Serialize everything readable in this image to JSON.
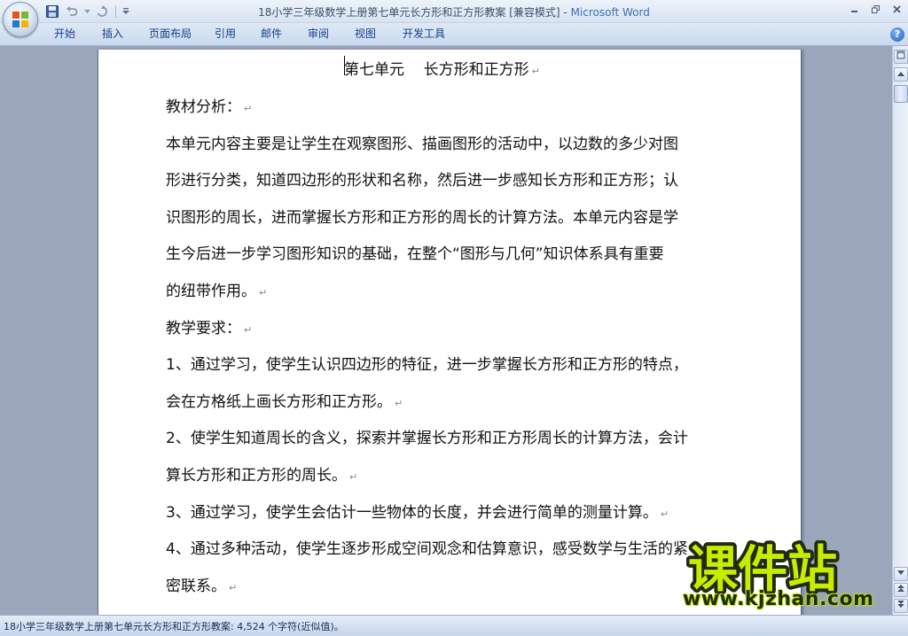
{
  "window": {
    "title_doc": "18小学三年级数学上册第七单元长方形和正方形教案 [兼容模式] - ",
    "title_app": "Microsoft Word"
  },
  "ribbon": {
    "tabs": [
      "开始",
      "插入",
      "页面布局",
      "引用",
      "邮件",
      "审阅",
      "视图",
      "开发工具"
    ]
  },
  "document": {
    "title": "第七单元    长方形和正方形",
    "lines": [
      {
        "text": "教材分析：",
        "pilcrow": true
      },
      {
        "text": "本单元内容主要是让学生在观察图形、描画图形的活动中，以边数的多少对图",
        "pilcrow": false
      },
      {
        "text": "形进行分类，知道四边形的形状和名称，然后进一步感知长方形和正方形；认",
        "pilcrow": false
      },
      {
        "text": "识图形的周长，进而掌握长方形和正方形的周长的计算方法。本单元内容是学",
        "pilcrow": false
      },
      {
        "text": "生今后进一步学习图形知识的基础，在整个“图形与几何”知识体系具有重要",
        "pilcrow": false
      },
      {
        "text": "的纽带作用。",
        "pilcrow": true
      },
      {
        "text": "教学要求：",
        "pilcrow": true
      },
      {
        "text": "1、通过学习，使学生认识四边形的特征，进一步掌握长方形和正方形的特点，",
        "pilcrow": false
      },
      {
        "text": "会在方格纸上画长方形和正方形。",
        "pilcrow": true
      },
      {
        "text": "2、使学生知道周长的含义，探索并掌握长方形和正方形周长的计算方法，会计",
        "pilcrow": false
      },
      {
        "text": "算长方形和正方形的周长。",
        "pilcrow": true
      },
      {
        "text": "3、通过学习，使学生会估计一些物体的长度，并会进行简单的测量计算。",
        "pilcrow": true
      },
      {
        "text": "4、通过多种活动，使学生逐步形成空间观念和估算意识，感受数学与生活的紧",
        "pilcrow": false
      },
      {
        "text": "密联系。",
        "pilcrow": true
      }
    ]
  },
  "statusbar": {
    "text": "18小学三年级数学上册第七单元长方形和正方形教案: 4,524 个字符(近似值)。"
  },
  "watermark": {
    "logo_text": "课件站",
    "url": "www.kjzhan.com"
  }
}
